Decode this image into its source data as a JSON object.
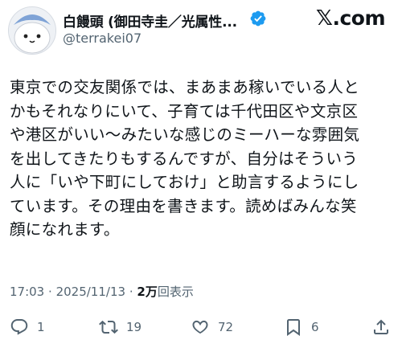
{
  "header": {
    "display_name": "白饅頭 (御田寺圭／光属性...",
    "handle": "@terrakei07",
    "site_logo": "𝕏",
    "site_suffix": ".com",
    "verified_icon": "verified-badge-icon",
    "colors": {
      "verified": "#1d9bf0"
    }
  },
  "post": {
    "lines": [
      "東京での交友関係では、まあまあ稼いでいる人と",
      "かもそれなりにいて、子育ては千代田区や文京区",
      "や港区がいい〜みたいな感じのミーハーな雰囲気",
      "を出してきたりもするんですが、自分はそういう",
      "人に「いや下町にしておけ」と助言するようにし",
      "ています。その理由を書きます。読めばみんな笑",
      "顔になれます。"
    ],
    "time": "17:03",
    "separator": "·",
    "date": "2025/11/13",
    "views_count": "2万",
    "views_label": "回表示"
  },
  "actions": {
    "reply_count": "1",
    "repost_count": "19",
    "like_count": "72",
    "bookmark_count": "6"
  }
}
